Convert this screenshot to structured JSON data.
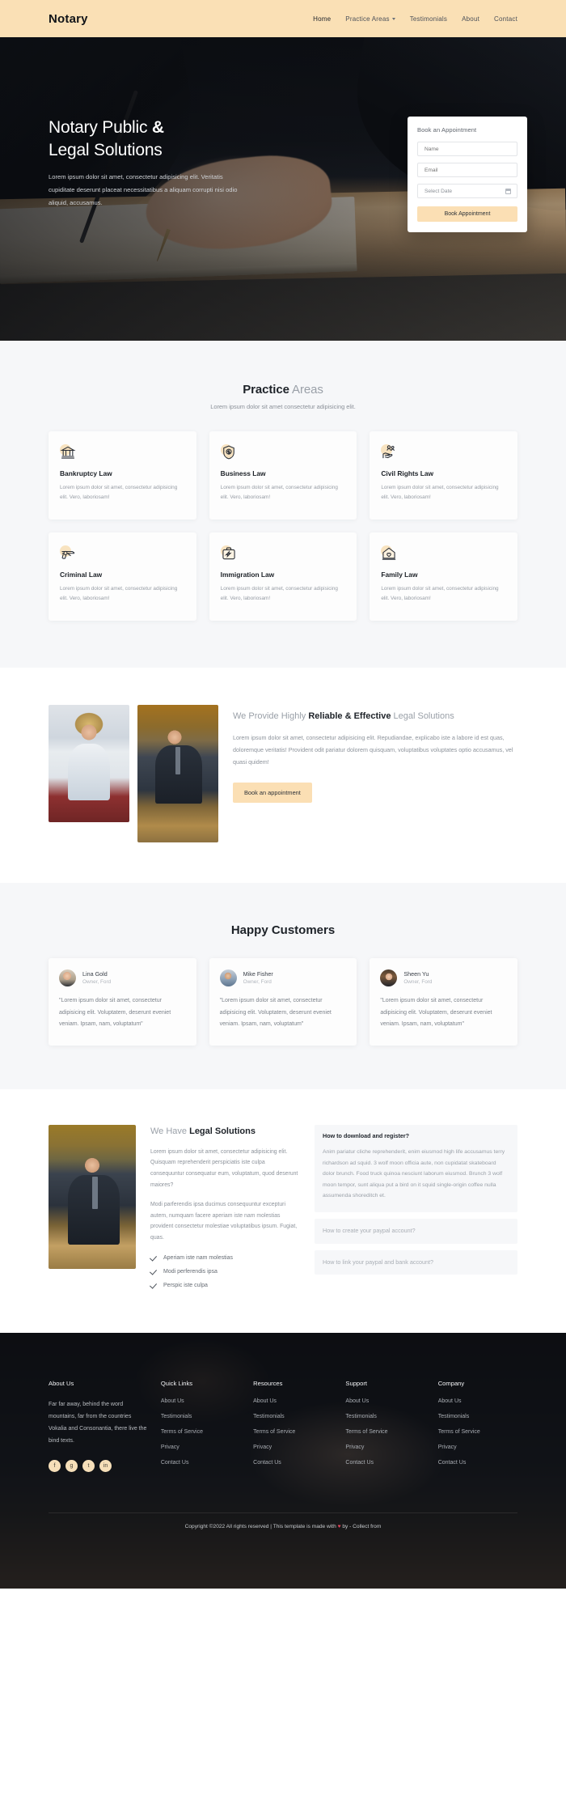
{
  "nav": {
    "brand": "Notary",
    "links": [
      {
        "label": "Home",
        "active": true,
        "caret": false
      },
      {
        "label": "Practice Areas",
        "active": false,
        "caret": true
      },
      {
        "label": "Testimonials",
        "active": false,
        "caret": false
      },
      {
        "label": "About",
        "active": false,
        "caret": false
      },
      {
        "label": "Contact",
        "active": false,
        "caret": false
      }
    ]
  },
  "hero": {
    "title_line1_light": "Notary Public ",
    "title_line1_bold": "&",
    "title_line2": "Legal Solutions",
    "paragraph": "Lorem ipsum dolor sit amet, consectetur adipisicing elit. Veritatis cupiditate deserunt placeat necessitatibus a aliquam corrupti nisi odio aliquid, accusamus.",
    "form": {
      "title": "Book an Appointment",
      "name_placeholder": "Name",
      "email_placeholder": "Email",
      "date_placeholder": "Select Date",
      "submit_label": "Book Appointment",
      "accent_color": "#fbdfb4"
    }
  },
  "practice": {
    "title_bold": "Practice",
    "title_light": " Areas",
    "subtitle": "Lorem ipsum dolor sit amet consectetur adipisicing elit.",
    "cards": [
      {
        "icon": "bank-icon",
        "title": "Bankruptcy Law",
        "text": "Lorem ipsum dolor sit amet, consectetur adipisicing elit. Vero, laboriosam!"
      },
      {
        "icon": "shield-dollar-icon",
        "title": "Business Law",
        "text": "Lorem ipsum dolor sit amet, consectetur adipisicing elit. Vero, laboriosam!"
      },
      {
        "icon": "hand-people-icon",
        "title": "Civil Rights Law",
        "text": "Lorem ipsum dolor sit amet, consectetur adipisicing elit. Vero, laboriosam!"
      },
      {
        "icon": "revolver-icon",
        "title": "Criminal Law",
        "text": "Lorem ipsum dolor sit amet, consectetur adipisicing elit. Vero, laboriosam!"
      },
      {
        "icon": "suitcase-plane-icon",
        "title": "Immigration Law",
        "text": "Lorem ipsum dolor sit amet, consectetur adipisicing elit. Vero, laboriosam!"
      },
      {
        "icon": "house-heart-icon",
        "title": "Family Law",
        "text": "Lorem ipsum dolor sit amet, consectetur adipisicing elit. Vero, laboriosam!"
      }
    ]
  },
  "reliable": {
    "title_1": "We Provide Highly ",
    "title_bold_1": "Reliable",
    "title_bold_2": "& Effective",
    "title_2": " Legal Solutions",
    "text": "Lorem ipsum dolor sit amet, consectetur adipisicing elit. Repudiandae, explicabo iste a labore id est quas, doloremque veritatis! Provident odit pariatur dolorem quisquam, voluptatibus voluptates optio accusamus, vel quasi quidem!",
    "button": "Book an appointment",
    "photo_1_alt": "woman-lawyer-photo",
    "photo_2_alt": "man-lawyer-desk-photo"
  },
  "testimonials": {
    "title": "Happy Customers",
    "items": [
      {
        "name": "Lina Gold",
        "role": "Owner, Ford",
        "quote": "\"Lorem ipsum dolor sit amet, consectetur adipisicing elit. Voluptatem, deserunt eveniet veniam. Ipsam, nam, voluptatum\""
      },
      {
        "name": "Mike Fisher",
        "role": "Owner, Ford",
        "quote": "\"Lorem ipsum dolor sit amet, consectetur adipisicing elit. Voluptatem, deserunt eveniet veniam. Ipsam, nam, voluptatum\""
      },
      {
        "name": "Sheen Yu",
        "role": "Owner, Ford",
        "quote": "\"Lorem ipsum dolor sit amet, consectetur adipisicing elit. Voluptatem, deserunt eveniet veniam. Ipsam, nam, voluptatum\""
      }
    ]
  },
  "legal": {
    "title_light": "We Have ",
    "title_bold": "Legal Solutions",
    "paragraph_1": "Lorem ipsum dolor sit amet, consectetur adipisicing elit. Quisquam reprehenderit perspiciatis iste culpa consequuntur consequatur eum, voluptatum, quod deserunt maiores?",
    "paragraph_2": "Modi parferendis ipsa ducimus consequuntur excepturi autem, numquam facere aperiam iste nam molestias provident consectetur molestiae voluptatibus ipsum. Fugiat, quas.",
    "checklist": [
      "Aperiam iste nam molestias",
      "Modi perferendis ipsa",
      "Perspic iste culpa"
    ],
    "photo_alt": "lawyer-gesturing-photo",
    "faq": [
      {
        "question": "How to download and register?",
        "answer": "Anim pariatur cliche reprehenderit, enim eiusmod high life accusamus terry richardson ad squid. 3 wolf moon officia aute, non cupidatat skateboard dolor brunch. Food truck quinoa nesciunt laborum eiusmod. Brunch 3 wolf moon tempor, sunt aliqua put a bird on it squid single-origin coffee nulla assumenda shoreditch et.",
        "open": true
      },
      {
        "question": "How to create your paypal account?",
        "answer": "",
        "open": false
      },
      {
        "question": "How to link your paypal and bank account?",
        "answer": "",
        "open": false
      }
    ]
  },
  "footer": {
    "columns": [
      {
        "heading": "About Us",
        "body": "Far far away, behind the word mountains, far from the countries Vokalia and Consonantia, there live the bind texts.",
        "socials": [
          "f",
          "g",
          "t",
          "in"
        ]
      },
      {
        "heading": "Quick Links",
        "links": [
          "About Us",
          "Testimonials",
          "Terms of Service",
          "Privacy",
          "Contact Us"
        ]
      },
      {
        "heading": "Resources",
        "links": [
          "About Us",
          "Testimonials",
          "Terms of Service",
          "Privacy",
          "Contact Us"
        ]
      },
      {
        "heading": "Support",
        "links": [
          "About Us",
          "Testimonials",
          "Terms of Service",
          "Privacy",
          "Contact Us"
        ]
      },
      {
        "heading": "Company",
        "links": [
          "About Us",
          "Testimonials",
          "Terms of Service",
          "Privacy",
          "Contact Us"
        ]
      }
    ],
    "copyright_before": "Copyright ©2022 All rights reserved | This template is made with ",
    "heart": "♥",
    "copyright_after": " by - Collect from"
  }
}
